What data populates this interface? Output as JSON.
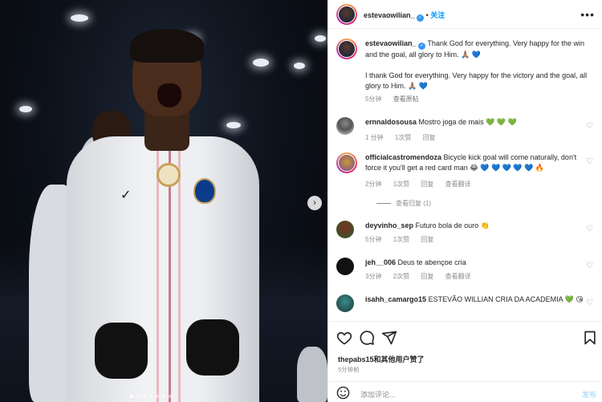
{
  "post": {
    "author": "estevaowilian_",
    "follow_label": "关注",
    "more_label": "•••",
    "caption": {
      "author": "estevaowilian_",
      "text": "Thank God for everything. Very happy for the win and the goal, all glory to Him. 🙏🏽 💙",
      "translation": "I thank God for everything. Very happy for the victory and the goal, all glory to Him. 🙏🏽 💙",
      "time": "5分钟",
      "view_original": "查看原帖"
    },
    "comments": [
      {
        "user": "ernnaldosousa",
        "text": "Mostro joga de mais 💚 💚 💚",
        "time": "1 分钟",
        "likes": "1次赞",
        "reply": "回复",
        "translate": ""
      },
      {
        "user": "officialcastromendoza",
        "text": "Bicycle kick goal will come naturally, don't force it you'll get a red card man 😂 💙 💙 💙 💙 💙 🔥",
        "time": "2分钟",
        "likes": "1次赞",
        "reply": "回复",
        "translate": "查看翻译",
        "view_replies": "查看回复 (1)"
      },
      {
        "user": "deyvinho_sep",
        "text": "Futuro bola de ouro 👏",
        "time": "5分钟",
        "likes": "1次赞",
        "reply": "回复",
        "translate": ""
      },
      {
        "user": "jeh__006",
        "text": "Deus te abençoe cria",
        "time": "3分钟",
        "likes": "2次赞",
        "reply": "回复",
        "translate": "查看翻译"
      },
      {
        "user": "isahh_camargo15",
        "text": "ESTEVÃO WILLIAN CRIA DA ACADEMIA 💚 😘",
        "time": "",
        "likes": "",
        "reply": "",
        "translate": ""
      }
    ],
    "likes_line": {
      "users": "thepabs15",
      "suffix": "和其他用户赞了"
    },
    "posted_time": "5分钟前",
    "add_comment_placeholder": "添加评论...",
    "post_label": "发布"
  },
  "icons": {
    "heart": "heart-icon",
    "comment": "comment-icon",
    "share": "share-icon",
    "save": "bookmark-icon",
    "emoji": "emoji-icon",
    "carousel_next": "chevron-right-icon"
  },
  "colors": {
    "accent": "#0095f6",
    "verified": "#3897f0",
    "muted": "#8e8e8e"
  }
}
